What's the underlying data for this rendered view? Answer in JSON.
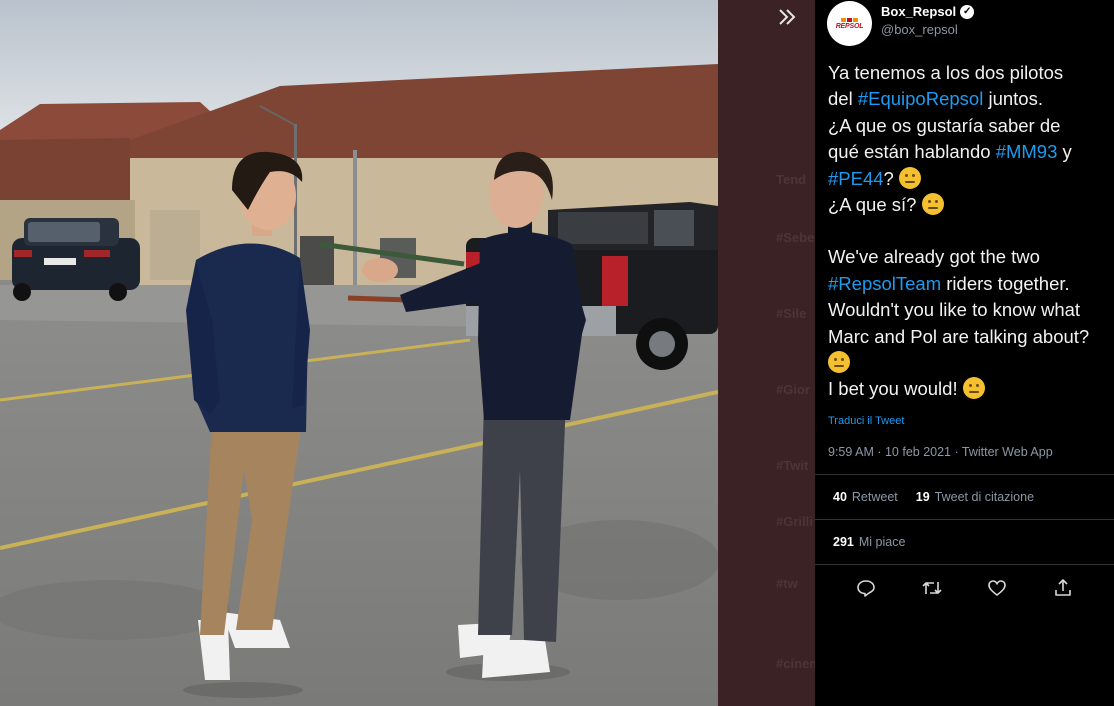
{
  "sidebar": {
    "expand_icon": "double-chevron-right-icon",
    "faded_items": [
      "Tend",
      "#Sebe",
      "#Sile",
      "#Gior",
      "#Twit",
      "#Grilli",
      "#tw",
      "#cinem"
    ]
  },
  "tweet": {
    "author": {
      "avatar_text": "REPSOL",
      "display_name": "Box_Repsol",
      "handle": "@box_repsol",
      "verified_icon": "verified-badge-icon"
    },
    "lines_es": [
      [
        "Ya tenemos a los dos pilotos"
      ],
      [
        "del ",
        "#EquipoRepsol",
        " juntos."
      ],
      [
        "¿A que os gustaría saber de"
      ],
      [
        "qué están hablando ",
        "#MM93",
        " y"
      ],
      [
        "#PE44",
        "? "
      ],
      [
        "¿A que sí? "
      ]
    ],
    "lines_en": [
      [
        "We've already got the two"
      ],
      [
        "#RepsolTeam",
        " riders together."
      ],
      [
        "Wouldn't you like to know what"
      ],
      [
        "Marc and Pol are talking about?"
      ],
      [
        ""
      ],
      [
        "I bet you would! "
      ]
    ],
    "translate_label": "Traduci il Tweet",
    "timestamp": "9:59 AM · 10 feb 2021 · Twitter Web App",
    "retweets": {
      "count": "40",
      "label": "Retweet"
    },
    "quotes": {
      "count": "19",
      "label": "Tweet di citazione"
    },
    "likes": {
      "count": "291",
      "label": "Mi piace"
    },
    "actions": [
      "reply-icon",
      "retweet-icon",
      "like-icon",
      "share-icon"
    ],
    "colors": {
      "link": "#1d9bf0",
      "muted": "#8b98a5",
      "background": "#000000",
      "brand_red": "#c20f1e",
      "brand_orange": "#f39200"
    }
  }
}
